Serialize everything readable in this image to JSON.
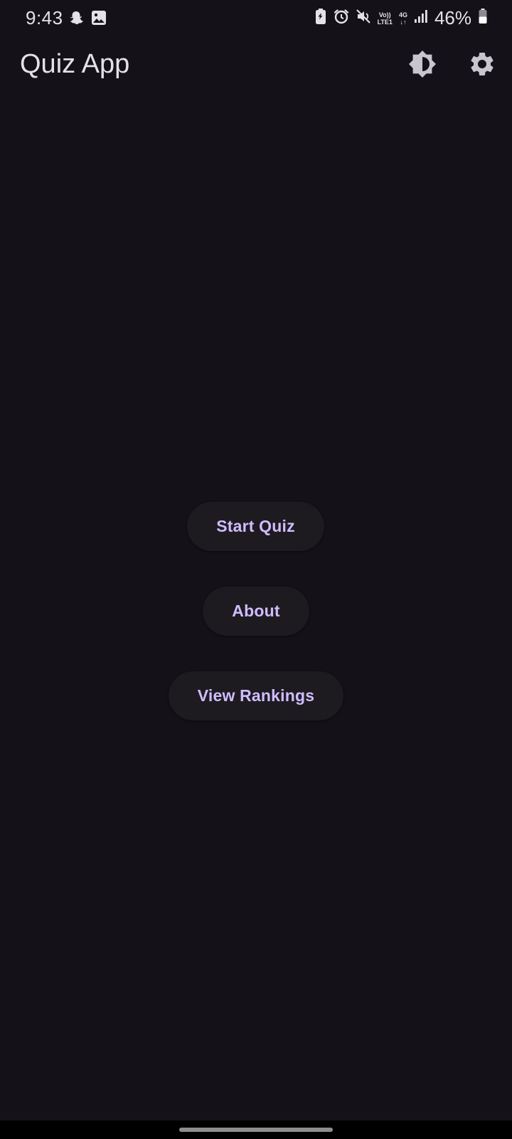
{
  "status_bar": {
    "time": "9:43",
    "battery_percent": "46%",
    "network": {
      "volte_top": "Vo))",
      "volte_bottom": "LTE1",
      "generation": "4G"
    },
    "icons": [
      "snapchat-icon",
      "gallery-icon",
      "battery-saver-icon",
      "alarm-icon",
      "mute-icon",
      "signal-icon",
      "battery-icon"
    ]
  },
  "app_bar": {
    "title": "Quiz App",
    "icons": [
      "brightness-icon",
      "gear-icon"
    ]
  },
  "menu": {
    "start_quiz": "Start Quiz",
    "about": "About",
    "view_rankings": "View Rankings"
  },
  "colors": {
    "background": "#141218",
    "button_surface": "#1d1b20",
    "accent_text": "#d0bcff",
    "on_surface": "#e6e0e9"
  }
}
